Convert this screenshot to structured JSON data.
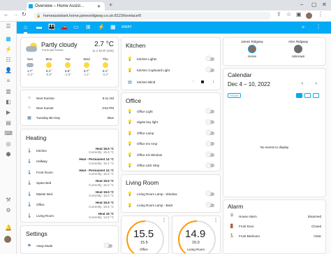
{
  "browser": {
    "tab_title": "Overview – Home Assist…",
    "url": "homeassistant.home.jamesridgway.co.uk:8123/lovelace/0"
  },
  "topbar": {
    "away_label": "AWAY"
  },
  "weather": {
    "condition": "Partly cloudy",
    "source": "Forecast Home",
    "temperature": "2.7 °C",
    "wind": "11.2 km/h (SW)",
    "forecast": [
      {
        "day": "Sun",
        "high": "1.7°",
        "low": "-2.2°",
        "icon": "cloudy"
      },
      {
        "day": "Mon",
        "high": "6.1°",
        "low": "-0.8°",
        "icon": "sunny"
      },
      {
        "day": "Tue",
        "high": "6.5°",
        "low": "-1.5°",
        "icon": "sunny"
      },
      {
        "day": "Wed",
        "high": "5.7°",
        "low": "-1.1°",
        "icon": "sunny"
      },
      {
        "day": "Thu",
        "high": "6.1°",
        "low": "-2.2°",
        "icon": "sunny"
      }
    ]
  },
  "sun_card": {
    "rows": [
      {
        "label": "Next Sunrise",
        "value": "8:11 AM"
      },
      {
        "label": "Next Sunset",
        "value": "3:54 PM"
      },
      {
        "label": "Tuesday Bin Day",
        "value": "Blue"
      }
    ]
  },
  "heating": {
    "title": "Heating",
    "rows": [
      {
        "label": "Kitchen",
        "heat": "Heat 15.5 °C",
        "current": "Currently: 15.9 °C"
      },
      {
        "label": "Hallway",
        "heat": "Heat - Permanent 14 °C",
        "current": "Currently: 15.4 °C"
      },
      {
        "label": "Front Room",
        "heat": "Heat - Permanent 14 °C",
        "current": "Currently: 15.5 °C"
      },
      {
        "label": "Spare Bed",
        "heat": "Heat 15.5 °C",
        "current": "Currently: 15.0 °C"
      },
      {
        "label": "Master Bed",
        "heat": "Heat 15.5 °C",
        "current": "Currently: 15.0 °C"
      },
      {
        "label": "Office",
        "heat": "Heat 15.5 °C",
        "current": "Currently: 15.5 °C"
      },
      {
        "label": "Living Room",
        "heat": "Heat 15 °C",
        "current": "Currently: 14.9 °C"
      }
    ]
  },
  "settings": {
    "title": "Settings",
    "rows": [
      {
        "label": "Away Mode"
      }
    ]
  },
  "kitchen": {
    "title": "Kitchen",
    "rows": [
      {
        "label": "Kitchen Lights"
      },
      {
        "label": "Kitchen Cupboard Light"
      },
      {
        "label": "Kitchen Blind"
      }
    ]
  },
  "office": {
    "title": "Office",
    "rows": [
      {
        "label": "Office Light"
      },
      {
        "label": "elgato key light"
      },
      {
        "label": "Office Lamp"
      },
      {
        "label": "Office Iris Amp"
      },
      {
        "label": "Office Iris Window"
      },
      {
        "label": "Office LED Strip"
      }
    ]
  },
  "living_room": {
    "title": "Living Room",
    "rows": [
      {
        "label": "Living Room Lamp - Window"
      },
      {
        "label": "Living Room Lamp - Back"
      }
    ]
  },
  "thermostats": [
    {
      "big": "15.5",
      "small": "15.5",
      "label": "Office"
    },
    {
      "big": "14.9",
      "small": "15.0",
      "label": "Living Room"
    }
  ],
  "people": [
    {
      "name": "James Ridgway",
      "state": "Home"
    },
    {
      "name": "Alice Ridgway",
      "state": "Unknown"
    }
  ],
  "calendar": {
    "title": "Calendar",
    "range": "Dec 4 – 10, 2022",
    "today_label": "TODAY",
    "empty": "No events to display"
  },
  "alarm": {
    "title": "Alarm",
    "rows": [
      {
        "label": "House Alarm",
        "value": "Disarmed"
      },
      {
        "label": "Front Door",
        "value": "Closed"
      },
      {
        "label": "Front Bedroom",
        "value": "Clear"
      }
    ]
  }
}
